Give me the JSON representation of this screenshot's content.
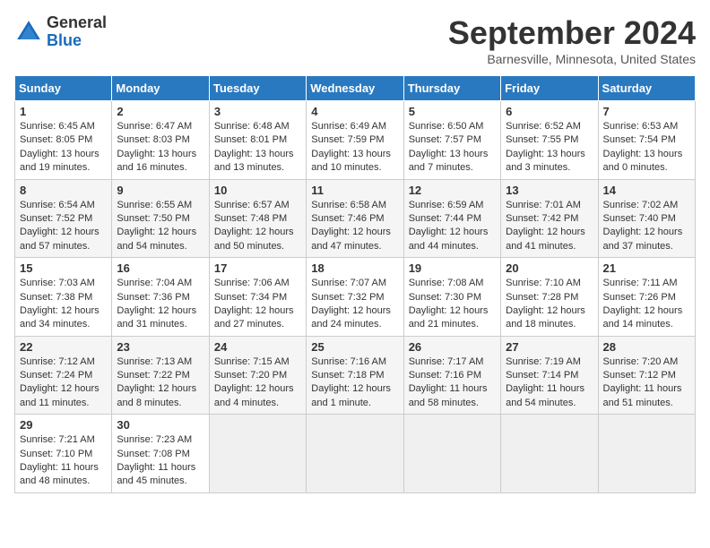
{
  "header": {
    "logo_general": "General",
    "logo_blue": "Blue",
    "month_title": "September 2024",
    "location": "Barnesville, Minnesota, United States"
  },
  "weekdays": [
    "Sunday",
    "Monday",
    "Tuesday",
    "Wednesday",
    "Thursday",
    "Friday",
    "Saturday"
  ],
  "weeks": [
    [
      {
        "day": "1",
        "sunrise": "6:45 AM",
        "sunset": "8:05 PM",
        "daylight": "13 hours and 19 minutes."
      },
      {
        "day": "2",
        "sunrise": "6:47 AM",
        "sunset": "8:03 PM",
        "daylight": "13 hours and 16 minutes."
      },
      {
        "day": "3",
        "sunrise": "6:48 AM",
        "sunset": "8:01 PM",
        "daylight": "13 hours and 13 minutes."
      },
      {
        "day": "4",
        "sunrise": "6:49 AM",
        "sunset": "7:59 PM",
        "daylight": "13 hours and 10 minutes."
      },
      {
        "day": "5",
        "sunrise": "6:50 AM",
        "sunset": "7:57 PM",
        "daylight": "13 hours and 7 minutes."
      },
      {
        "day": "6",
        "sunrise": "6:52 AM",
        "sunset": "7:55 PM",
        "daylight": "13 hours and 3 minutes."
      },
      {
        "day": "7",
        "sunrise": "6:53 AM",
        "sunset": "7:54 PM",
        "daylight": "13 hours and 0 minutes."
      }
    ],
    [
      {
        "day": "8",
        "sunrise": "6:54 AM",
        "sunset": "7:52 PM",
        "daylight": "12 hours and 57 minutes."
      },
      {
        "day": "9",
        "sunrise": "6:55 AM",
        "sunset": "7:50 PM",
        "daylight": "12 hours and 54 minutes."
      },
      {
        "day": "10",
        "sunrise": "6:57 AM",
        "sunset": "7:48 PM",
        "daylight": "12 hours and 50 minutes."
      },
      {
        "day": "11",
        "sunrise": "6:58 AM",
        "sunset": "7:46 PM",
        "daylight": "12 hours and 47 minutes."
      },
      {
        "day": "12",
        "sunrise": "6:59 AM",
        "sunset": "7:44 PM",
        "daylight": "12 hours and 44 minutes."
      },
      {
        "day": "13",
        "sunrise": "7:01 AM",
        "sunset": "7:42 PM",
        "daylight": "12 hours and 41 minutes."
      },
      {
        "day": "14",
        "sunrise": "7:02 AM",
        "sunset": "7:40 PM",
        "daylight": "12 hours and 37 minutes."
      }
    ],
    [
      {
        "day": "15",
        "sunrise": "7:03 AM",
        "sunset": "7:38 PM",
        "daylight": "12 hours and 34 minutes."
      },
      {
        "day": "16",
        "sunrise": "7:04 AM",
        "sunset": "7:36 PM",
        "daylight": "12 hours and 31 minutes."
      },
      {
        "day": "17",
        "sunrise": "7:06 AM",
        "sunset": "7:34 PM",
        "daylight": "12 hours and 27 minutes."
      },
      {
        "day": "18",
        "sunrise": "7:07 AM",
        "sunset": "7:32 PM",
        "daylight": "12 hours and 24 minutes."
      },
      {
        "day": "19",
        "sunrise": "7:08 AM",
        "sunset": "7:30 PM",
        "daylight": "12 hours and 21 minutes."
      },
      {
        "day": "20",
        "sunrise": "7:10 AM",
        "sunset": "7:28 PM",
        "daylight": "12 hours and 18 minutes."
      },
      {
        "day": "21",
        "sunrise": "7:11 AM",
        "sunset": "7:26 PM",
        "daylight": "12 hours and 14 minutes."
      }
    ],
    [
      {
        "day": "22",
        "sunrise": "7:12 AM",
        "sunset": "7:24 PM",
        "daylight": "12 hours and 11 minutes."
      },
      {
        "day": "23",
        "sunrise": "7:13 AM",
        "sunset": "7:22 PM",
        "daylight": "12 hours and 8 minutes."
      },
      {
        "day": "24",
        "sunrise": "7:15 AM",
        "sunset": "7:20 PM",
        "daylight": "12 hours and 4 minutes."
      },
      {
        "day": "25",
        "sunrise": "7:16 AM",
        "sunset": "7:18 PM",
        "daylight": "12 hours and 1 minute."
      },
      {
        "day": "26",
        "sunrise": "7:17 AM",
        "sunset": "7:16 PM",
        "daylight": "11 hours and 58 minutes."
      },
      {
        "day": "27",
        "sunrise": "7:19 AM",
        "sunset": "7:14 PM",
        "daylight": "11 hours and 54 minutes."
      },
      {
        "day": "28",
        "sunrise": "7:20 AM",
        "sunset": "7:12 PM",
        "daylight": "11 hours and 51 minutes."
      }
    ],
    [
      {
        "day": "29",
        "sunrise": "7:21 AM",
        "sunset": "7:10 PM",
        "daylight": "11 hours and 48 minutes."
      },
      {
        "day": "30",
        "sunrise": "7:23 AM",
        "sunset": "7:08 PM",
        "daylight": "11 hours and 45 minutes."
      },
      null,
      null,
      null,
      null,
      null
    ]
  ]
}
